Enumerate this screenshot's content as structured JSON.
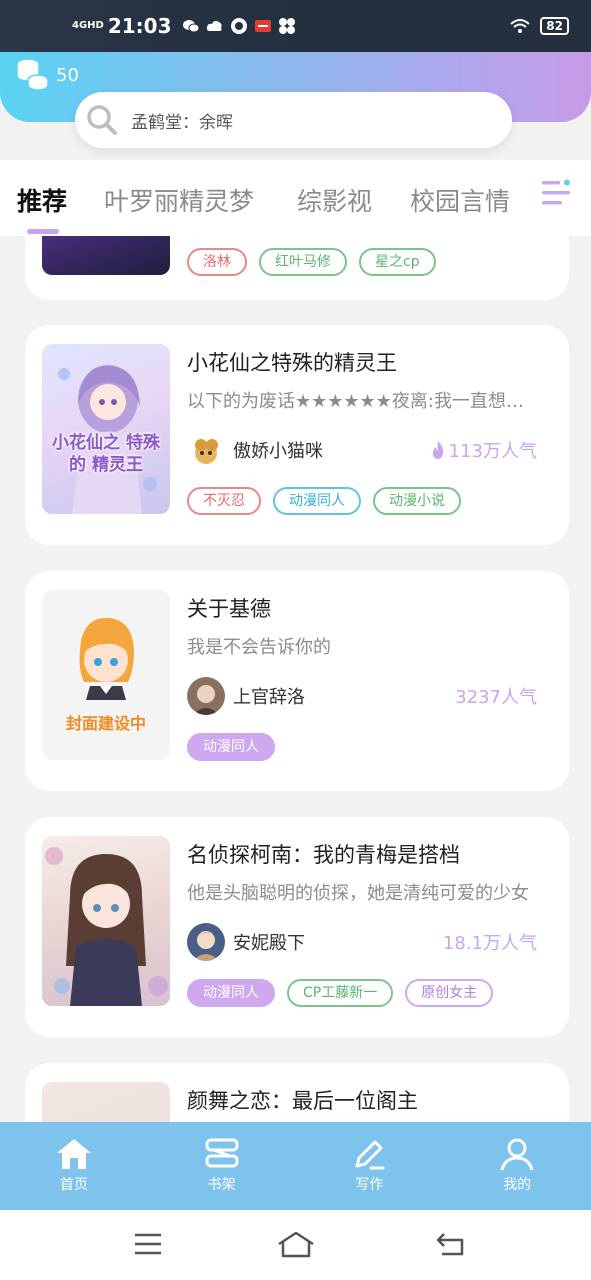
{
  "status_bar": {
    "network": "4GHD",
    "time": "21:03",
    "battery": "82",
    "icons": [
      "wechat-icon",
      "cloud-icon",
      "app-icon",
      "news-app-icon",
      "fan-icon",
      "wifi-icon",
      "battery-icon"
    ]
  },
  "header": {
    "coin_count": "50",
    "search_placeholder": "孟鹤堂：余晖"
  },
  "tabs": [
    {
      "label": "推荐",
      "active": true
    },
    {
      "label": "叶罗丽精灵梦",
      "active": false
    },
    {
      "label": "综影视",
      "active": false
    },
    {
      "label": "校园言情",
      "active": false
    }
  ],
  "books": [
    {
      "title": "",
      "tags": [
        {
          "label": "洛林",
          "style": "red"
        },
        {
          "label": "红叶马修",
          "style": "green"
        },
        {
          "label": "星之cp",
          "style": "green"
        }
      ]
    },
    {
      "title": "小花仙之特殊的精灵王",
      "description": "以下的为废话★★★★★★夜离:我一直想写小花仙的同人",
      "author": "傲娇小猫咪",
      "popularity": "113万人气",
      "cover_text": "小花仙之 特殊的 精灵王",
      "tags": [
        {
          "label": "不灭忍",
          "style": "red"
        },
        {
          "label": "动漫同人",
          "style": "cyan"
        },
        {
          "label": "动漫小说",
          "style": "green"
        }
      ]
    },
    {
      "title": "关于基德",
      "description": "我是不会告诉你的",
      "author": "上官辞洛",
      "popularity": "3237人气",
      "cover_text": "封面建设中",
      "tags": [
        {
          "label": "动漫同人",
          "style": "filled"
        }
      ]
    },
    {
      "title": "名侦探柯南：我的青梅是搭档",
      "description": "他是头脑聪明的侦探，她是清纯可爱的少女",
      "author": "安妮殿下",
      "popularity": "18.1万人气",
      "tags": [
        {
          "label": "动漫同人",
          "style": "filled"
        },
        {
          "label": "CP工藤新一",
          "style": "green"
        },
        {
          "label": "原创女主",
          "style": "purple"
        }
      ]
    },
    {
      "title": "颜舞之恋：最后一位阁主"
    }
  ],
  "bottom_nav": [
    {
      "label": "首页",
      "icon": "home-icon"
    },
    {
      "label": "书架",
      "icon": "bookshelf-icon"
    },
    {
      "label": "写作",
      "icon": "pen-icon"
    },
    {
      "label": "我的",
      "icon": "user-icon"
    }
  ],
  "colors": {
    "accent": "#c8a6ee",
    "nav_bg": "#7ec3eb",
    "header_gradient_start": "#5ad3f3",
    "header_gradient_end": "#c79ae8"
  }
}
